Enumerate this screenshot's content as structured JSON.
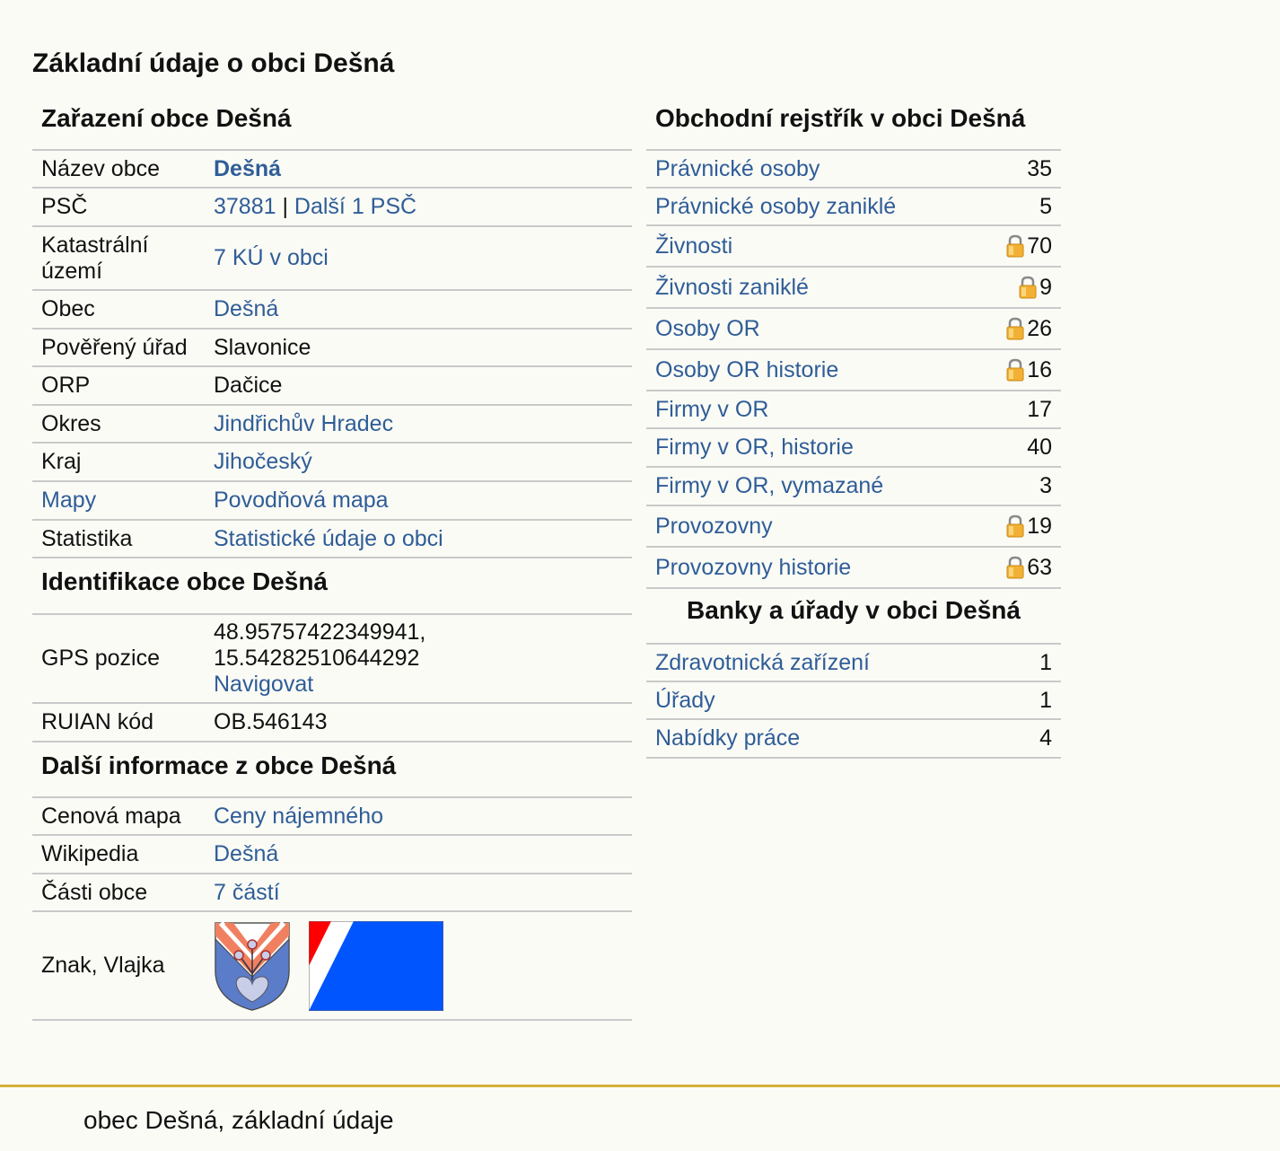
{
  "page_title": "Základní údaje o obci Dešná",
  "zarazeni": {
    "heading": "Zařazení obce Dešná",
    "nazev_obce": {
      "key": "Název obce",
      "value": "Dešná"
    },
    "psc": {
      "key": "PSČ",
      "value": "37881",
      "separator": " | ",
      "more": "Další 1 PSČ"
    },
    "katastr": {
      "key": "Katastrální území",
      "value": "7 KÚ v obci"
    },
    "obec": {
      "key": "Obec",
      "value": "Dešná"
    },
    "poverovany": {
      "key": "Pověřený úřad",
      "value": "Slavonice"
    },
    "orp": {
      "key": "ORP",
      "value": "Dačice"
    },
    "okres": {
      "key": "Okres",
      "value": "Jindřichův Hradec"
    },
    "kraj": {
      "key": "Kraj",
      "value": "Jihočeský"
    },
    "mapy": {
      "key": "Mapy",
      "value": "Povodňová mapa"
    },
    "statistika": {
      "key": "Statistika",
      "value": "Statistické údaje o obci"
    }
  },
  "identifikace": {
    "heading": "Identifikace obce Dešná",
    "gps": {
      "key": "GPS pozice",
      "lat": "48.95757422349941,",
      "lon": "15.54282510644292",
      "navigate": "Navigovat"
    },
    "ruian": {
      "key": "RUIAN kód",
      "value": "OB.546143"
    }
  },
  "dalsi": {
    "heading": "Další informace z obce Dešná",
    "cenova": {
      "key": "Cenová mapa",
      "value": "Ceny nájemného"
    },
    "wiki": {
      "key": "Wikipedia",
      "value": "Dešná"
    },
    "casti": {
      "key": "Části obce",
      "value": "7 částí"
    },
    "znak": {
      "key": "Znak, Vlajka"
    }
  },
  "rejstrik": {
    "heading": "Obchodní rejstřík v obci Dešná",
    "items": [
      {
        "label": "Právnické osoby",
        "count": "35",
        "locked": false
      },
      {
        "label": "Právnické osoby zaniklé",
        "count": "5",
        "locked": false
      },
      {
        "label": "Živnosti",
        "count": "70",
        "locked": true
      },
      {
        "label": "Živnosti zaniklé",
        "count": "9",
        "locked": true
      },
      {
        "label": "Osoby OR",
        "count": "26",
        "locked": true
      },
      {
        "label": "Osoby OR historie",
        "count": "16",
        "locked": true
      },
      {
        "label": "Firmy v OR",
        "count": "17",
        "locked": false
      },
      {
        "label": "Firmy v OR, historie",
        "count": "40",
        "locked": false
      },
      {
        "label": "Firmy v OR, vymazané",
        "count": "3",
        "locked": false
      },
      {
        "label": "Provozovny",
        "count": "19",
        "locked": true
      },
      {
        "label": "Provozovny historie",
        "count": "63",
        "locked": true
      }
    ]
  },
  "banky": {
    "heading": "Banky a úřady v obci Dešná",
    "items": [
      {
        "label": "Zdravotnická zařízení",
        "count": "1"
      },
      {
        "label": "Úřady",
        "count": "1"
      },
      {
        "label": "Nabídky práce",
        "count": "4"
      }
    ]
  },
  "footer": "obec Dešná, základní údaje",
  "colors": {
    "link": "#2f5d97",
    "footer_line": "#d4b036",
    "flag_blue": "#0055ff",
    "flag_red": "#ff0000"
  }
}
